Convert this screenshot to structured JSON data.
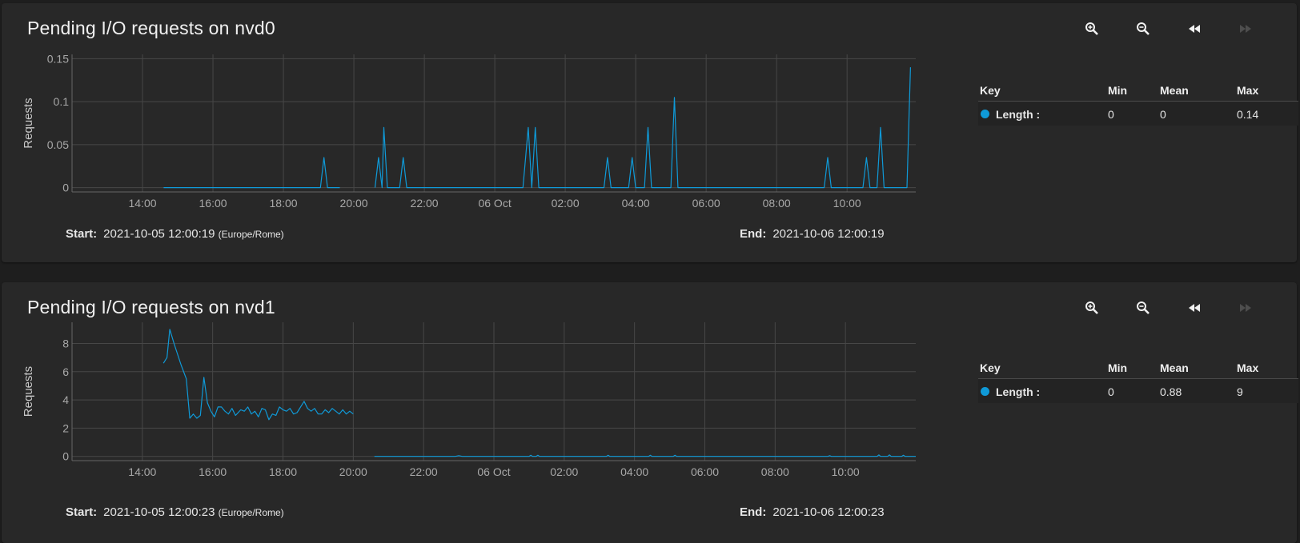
{
  "colors": {
    "series": "#0f9ad8",
    "grid": "#474747",
    "axis_text": "#a8a8a8"
  },
  "toolbar_icons": [
    "zoom-in-icon",
    "zoom-out-icon",
    "rewind-icon",
    "fast-forward-icon"
  ],
  "cards": [
    {
      "title": "Pending I/O requests on nvd0",
      "start_label": "Start:",
      "start_value": "2021-10-05 12:00:19",
      "timezone": "(Europe/Rome)",
      "end_label": "End:",
      "end_value": "2021-10-06 12:00:19",
      "legend": {
        "headers": {
          "key": "Key",
          "min": "Min",
          "mean": "Mean",
          "max": "Max"
        },
        "rows": [
          {
            "name": "Length :",
            "min": "0",
            "mean": "0",
            "max": "0.14"
          }
        ]
      }
    },
    {
      "title": "Pending I/O requests on nvd1",
      "start_label": "Start:",
      "start_value": "2021-10-05 12:00:23",
      "timezone": "(Europe/Rome)",
      "end_label": "End:",
      "end_value": "2021-10-06 12:00:23",
      "legend": {
        "headers": {
          "key": "Key",
          "min": "Min",
          "mean": "Mean",
          "max": "Max"
        },
        "rows": [
          {
            "name": "Length :",
            "min": "0",
            "mean": "0.88",
            "max": "9"
          }
        ]
      }
    }
  ],
  "chart_data": [
    {
      "type": "line",
      "ylabel": "Requests",
      "x_range": [
        12.0,
        35.95
      ],
      "ylim": [
        -0.005,
        0.155
      ],
      "y_ticks": [
        0,
        0.05,
        0.1,
        0.15
      ],
      "y_tick_labels": [
        "0",
        "0.05",
        "0.1",
        "0.15"
      ],
      "x_ticks": [
        14,
        16,
        18,
        20,
        22,
        24,
        26,
        28,
        30,
        32,
        34
      ],
      "x_tick_labels": [
        "14:00",
        "16:00",
        "18:00",
        "20:00",
        "22:00",
        "06 Oct",
        "02:00",
        "04:00",
        "06:00",
        "08:00",
        "10:00"
      ],
      "grid": true,
      "series": [
        {
          "name": "Length",
          "segments": [
            [
              [
                14.6,
                0
              ],
              [
                16.0,
                0
              ],
              [
                18.0,
                0
              ],
              [
                19.05,
                0
              ],
              [
                19.15,
                0.035
              ],
              [
                19.25,
                0
              ],
              [
                19.6,
                0
              ]
            ],
            [
              [
                20.6,
                0
              ],
              [
                20.7,
                0.035
              ],
              [
                20.8,
                0
              ],
              [
                20.85,
                0.07
              ],
              [
                20.95,
                0
              ],
              [
                21.3,
                0
              ],
              [
                21.4,
                0.035
              ],
              [
                21.5,
                0
              ],
              [
                24.8,
                0
              ],
              [
                24.95,
                0.07
              ],
              [
                25.05,
                0
              ],
              [
                25.15,
                0.07
              ],
              [
                25.25,
                0
              ],
              [
                27.1,
                0
              ],
              [
                27.2,
                0.035
              ],
              [
                27.3,
                0
              ],
              [
                27.8,
                0
              ],
              [
                27.9,
                0.035
              ],
              [
                28.0,
                0
              ],
              [
                28.25,
                0
              ],
              [
                28.35,
                0.07
              ],
              [
                28.45,
                0
              ],
              [
                29.0,
                0
              ],
              [
                29.1,
                0.105
              ],
              [
                29.2,
                0
              ],
              [
                33.35,
                0
              ],
              [
                33.45,
                0.035
              ],
              [
                33.55,
                0
              ],
              [
                34.45,
                0
              ],
              [
                34.55,
                0.035
              ],
              [
                34.65,
                0
              ],
              [
                34.85,
                0
              ],
              [
                34.95,
                0.07
              ],
              [
                35.05,
                0
              ],
              [
                35.7,
                0
              ],
              [
                35.8,
                0.14
              ]
            ]
          ]
        }
      ]
    },
    {
      "type": "line",
      "ylabel": "Requests",
      "x_range": [
        12.0,
        36.0
      ],
      "ylim": [
        -0.3,
        9.5
      ],
      "y_ticks": [
        0,
        2,
        4,
        6,
        8
      ],
      "y_tick_labels": [
        "0",
        "2",
        "4",
        "6",
        "8"
      ],
      "x_ticks": [
        14,
        16,
        18,
        20,
        22,
        24,
        26,
        28,
        30,
        32,
        34
      ],
      "x_tick_labels": [
        "14:00",
        "16:00",
        "18:00",
        "20:00",
        "22:00",
        "06 Oct",
        "02:00",
        "04:00",
        "06:00",
        "08:00",
        "10:00"
      ],
      "grid": true,
      "series": [
        {
          "name": "Length",
          "segments": [
            [
              [
                14.6,
                6.6
              ],
              [
                14.7,
                7.0
              ],
              [
                14.78,
                9.0
              ],
              [
                14.9,
                8.0
              ],
              [
                15.1,
                6.5
              ],
              [
                15.25,
                5.5
              ],
              [
                15.35,
                2.7
              ],
              [
                15.45,
                3.0
              ],
              [
                15.55,
                2.7
              ],
              [
                15.65,
                2.9
              ],
              [
                15.75,
                5.6
              ],
              [
                15.85,
                3.8
              ],
              [
                15.95,
                3.2
              ],
              [
                16.05,
                2.8
              ],
              [
                16.15,
                3.5
              ],
              [
                16.25,
                3.5
              ],
              [
                16.35,
                3.2
              ],
              [
                16.45,
                3.0
              ],
              [
                16.55,
                3.4
              ],
              [
                16.65,
                2.9
              ],
              [
                16.8,
                3.3
              ],
              [
                16.9,
                3.2
              ],
              [
                17.0,
                3.5
              ],
              [
                17.1,
                3.0
              ],
              [
                17.2,
                3.2
              ],
              [
                17.3,
                2.8
              ],
              [
                17.4,
                3.4
              ],
              [
                17.5,
                3.3
              ],
              [
                17.6,
                2.6
              ],
              [
                17.7,
                3.0
              ],
              [
                17.8,
                2.9
              ],
              [
                17.9,
                3.5
              ],
              [
                18.0,
                3.3
              ],
              [
                18.1,
                3.2
              ],
              [
                18.2,
                3.4
              ],
              [
                18.3,
                3.0
              ],
              [
                18.4,
                3.1
              ],
              [
                18.5,
                3.5
              ],
              [
                18.6,
                3.9
              ],
              [
                18.7,
                3.4
              ],
              [
                18.8,
                3.2
              ],
              [
                18.9,
                3.4
              ],
              [
                19.0,
                3.0
              ],
              [
                19.1,
                3.0
              ],
              [
                19.2,
                3.3
              ],
              [
                19.3,
                3.1
              ],
              [
                19.4,
                3.4
              ],
              [
                19.5,
                3.2
              ],
              [
                19.6,
                3.0
              ],
              [
                19.7,
                3.3
              ],
              [
                19.8,
                3.0
              ],
              [
                19.9,
                3.2
              ],
              [
                20.0,
                3.0
              ]
            ],
            [
              [
                20.6,
                0
              ],
              [
                22.0,
                0
              ],
              [
                22.9,
                0
              ],
              [
                23.0,
                0.05
              ],
              [
                23.1,
                0
              ],
              [
                25.0,
                0
              ],
              [
                25.05,
                0.08
              ],
              [
                25.1,
                0
              ],
              [
                25.2,
                0
              ],
              [
                25.25,
                0.08
              ],
              [
                25.3,
                0
              ],
              [
                27.2,
                0
              ],
              [
                27.25,
                0.08
              ],
              [
                27.3,
                0
              ],
              [
                28.4,
                0
              ],
              [
                28.45,
                0.08
              ],
              [
                28.5,
                0
              ],
              [
                29.1,
                0
              ],
              [
                29.15,
                0.08
              ],
              [
                29.2,
                0
              ],
              [
                33.5,
                0
              ],
              [
                33.55,
                0.05
              ],
              [
                33.6,
                0
              ],
              [
                34.9,
                0
              ],
              [
                34.95,
                0.1
              ],
              [
                35.0,
                0
              ],
              [
                35.2,
                0
              ],
              [
                35.25,
                0.1
              ],
              [
                35.3,
                0
              ],
              [
                35.6,
                0
              ],
              [
                35.65,
                0.08
              ],
              [
                35.7,
                0
              ],
              [
                36.0,
                0
              ]
            ]
          ]
        }
      ]
    }
  ]
}
